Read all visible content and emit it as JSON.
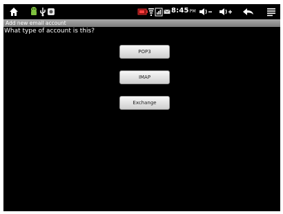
{
  "status_bar": {
    "time": "8:45",
    "ampm": "PM",
    "icons": [
      "home-icon",
      "android-icon",
      "usb-icon",
      "notification-icon",
      "battery-icon",
      "wifi-icon",
      "signal-icon",
      "mail-icon",
      "volume-down-icon",
      "volume-up-icon",
      "back-icon",
      "menu-icon"
    ]
  },
  "title_bar": {
    "title": "Add new email account"
  },
  "main": {
    "question": "What type of account is this?",
    "buttons": [
      {
        "label": "POP3"
      },
      {
        "label": "IMAP"
      },
      {
        "label": "Exchange"
      }
    ]
  },
  "colors": {
    "screen_bg": "#000000",
    "title_bar": "#8f8f8f",
    "button_bg": "#e6e6e6"
  }
}
